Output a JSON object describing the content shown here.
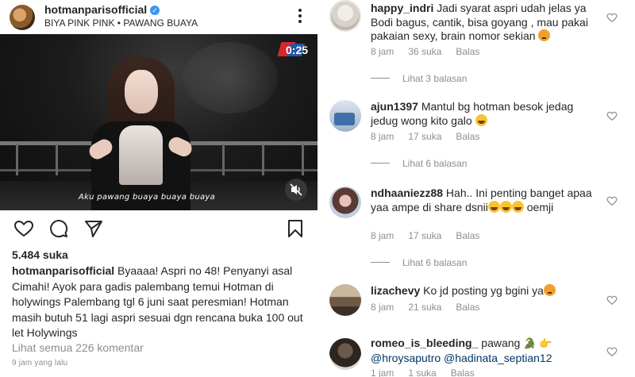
{
  "post": {
    "account": "hotmanparisofficial",
    "verified_icon": "verified-badge-icon",
    "subtitle": "BIYA PINK PINK • PAWANG BUAYA",
    "video": {
      "timer": "0:25",
      "caption": "Aku pawang buaya buaya buaya"
    },
    "likes": "5.484 suka",
    "caption_user": "hotmanparisofficial",
    "caption_text": " Byaaaa! Aspri no 48! Penyanyi asal Cimahi! Ayok para gadis palembang temui Hotman di holywings Palembang tgl 6 juni saat peresmian! Hotman masih butuh 51 lagi aspri sesuai dgn rencana buka 100 out let Holywings",
    "view_all": "Lihat semua 226 komentar",
    "time_ago": "9 jam yang lalu"
  },
  "comments": [
    {
      "user": "happy_indri",
      "text": " Jadi syarat aspri udah jelas ya Bodi bagus, cantik, bisa goyang , mau pakai pakaian sexy, brain nomor sekian",
      "time": "8 jam",
      "likes": "36 suka",
      "reply": "Balas",
      "replies": "Lihat 3 balasan"
    },
    {
      "user": "ajun1397",
      "text": " Mantul bg hotman besok jedag jedug wong kito galo ",
      "time": "8 jam",
      "likes": "17 suka",
      "reply": "Balas",
      "replies": "Lihat 6 balasan"
    },
    {
      "user": "ndhaaniezz88",
      "text": " Hah.. Ini penting banget apaa yaa ampe di share dsnii",
      "text_end": " oemji",
      "time": "8 jam",
      "likes": "17 suka",
      "reply": "Balas",
      "replies": "Lihat 6 balasan"
    },
    {
      "user": "lizachevy",
      "text": " Ko jd posting yg bgini ya",
      "time": "8 jam",
      "likes": "21 suka",
      "reply": "Balas"
    },
    {
      "user": "romeo_is_bleeding_",
      "text": " pawang ",
      "mention1": "@hroysaputro",
      "mention2": "@hadinata_septian12",
      "time": "1 jam",
      "likes": "1 suka",
      "reply": "Balas"
    }
  ],
  "colors": {
    "text": "#262626",
    "muted": "#8e8e8e",
    "mention": "#00376b",
    "verified": "#3897f0"
  }
}
